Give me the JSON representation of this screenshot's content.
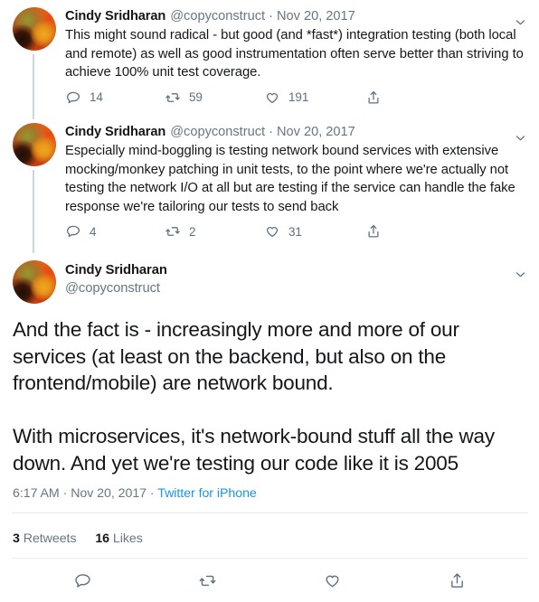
{
  "thread": {
    "replies": [
      {
        "display_name": "Cindy Sridharan",
        "handle": "@copyconstruct",
        "separator": "·",
        "date": "Nov 20, 2017",
        "text": "This might sound radical - but good (and *fast*) integration testing (both local and remote) as well as good instrumentation often serve better than striving to achieve 100% unit test coverage.",
        "actions": {
          "reply_count": "14",
          "retweet_count": "59",
          "like_count": "191"
        }
      },
      {
        "display_name": "Cindy Sridharan",
        "handle": "@copyconstruct",
        "separator": "·",
        "date": "Nov 20, 2017",
        "text": "Especially mind-boggling is testing network bound services with extensive mocking/monkey patching in unit tests, to the point where we're actually not testing the network I/O at all but are testing if the service can handle the fake response we're tailoring our tests to send back",
        "actions": {
          "reply_count": "4",
          "retweet_count": "2",
          "like_count": "31"
        }
      }
    ],
    "focused_tweet": {
      "display_name": "Cindy Sridharan",
      "handle": "@copyconstruct",
      "text": "And the fact is - increasingly more and more of our services (at least on the backend, but also on the frontend/mobile) are network bound.\n\nWith microservices, it's network-bound stuff all the way down. And yet we're testing our code like it is 2005",
      "meta": {
        "time": "6:17 AM",
        "separator_1": "·",
        "date": "Nov 20, 2017",
        "separator_2": "·",
        "source": "Twitter for iPhone"
      },
      "stats": {
        "retweets_count": "3",
        "retweets_label": "Retweets",
        "likes_count": "16",
        "likes_label": "Likes"
      },
      "actions": {
        "reply": "reply-icon",
        "retweet": "retweet-icon",
        "like": "like-icon",
        "share": "share-icon"
      }
    }
  },
  "icons": {
    "caret": "chevron-down-icon",
    "reply": "reply-icon",
    "retweet": "retweet-icon",
    "like": "heart-icon",
    "share": "share-icon",
    "avatar": "user-avatar"
  },
  "colors": {
    "text_primary": "#14171a",
    "text_secondary": "#657786",
    "action_icon": "#5b7083",
    "link": "#1b95e0",
    "divider": "#e6ecf0",
    "thread_line": "#ccd6dd"
  }
}
